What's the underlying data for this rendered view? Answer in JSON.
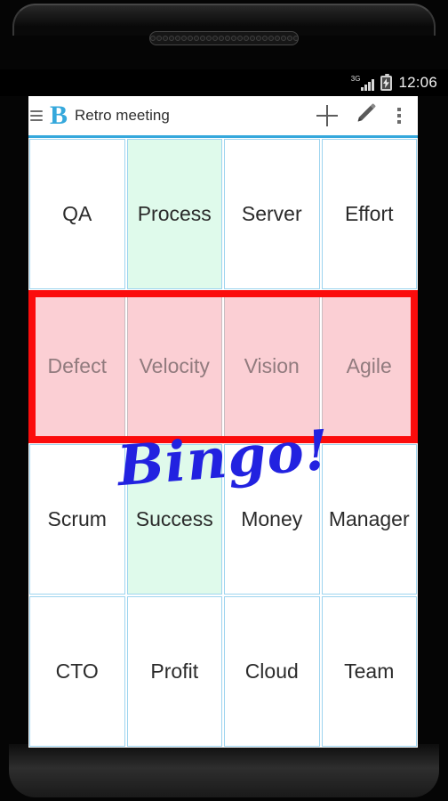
{
  "device": {
    "speaker_hole_count": 24
  },
  "statusbar": {
    "network_label": "3G",
    "network_icon": "signal-bars-icon",
    "battery_icon": "battery-charging-icon",
    "clock": "12:06"
  },
  "toolbar": {
    "menu_icon": "hamburger-menu-icon",
    "logo_letter": "B",
    "title": "Retro meeting",
    "add_icon": "plus-icon",
    "add_label": "+",
    "edit_icon": "pencil-icon",
    "overflow_icon": "more-vertical-icon"
  },
  "board": {
    "columns": 4,
    "rows": 4,
    "winning_row_index": 1,
    "colors": {
      "cell_border": "#9ed4ef",
      "cell_background": "#ffffff",
      "marked_background": "#dffaeb",
      "win_background": "#fbcfd4",
      "win_outline": "#fb0c0c",
      "accent": "#35a8dc",
      "bingo_text": "#2222e0",
      "win_text": "#917b7e"
    },
    "cells": [
      {
        "label": "QA",
        "state": "empty"
      },
      {
        "label": "Process",
        "state": "marked"
      },
      {
        "label": "Server",
        "state": "empty"
      },
      {
        "label": "Effort",
        "state": "empty"
      },
      {
        "label": "Defect",
        "state": "win"
      },
      {
        "label": "Velocity",
        "state": "win"
      },
      {
        "label": "Vision",
        "state": "win"
      },
      {
        "label": "Agile",
        "state": "win"
      },
      {
        "label": "Scrum",
        "state": "empty"
      },
      {
        "label": "Success",
        "state": "marked"
      },
      {
        "label": "Money",
        "state": "empty"
      },
      {
        "label": "Manager",
        "state": "empty"
      },
      {
        "label": "CTO",
        "state": "empty"
      },
      {
        "label": "Profit",
        "state": "empty"
      },
      {
        "label": "Cloud",
        "state": "empty"
      },
      {
        "label": "Team",
        "state": "empty"
      }
    ]
  },
  "overlay": {
    "bingo_text": "Bingo!"
  }
}
